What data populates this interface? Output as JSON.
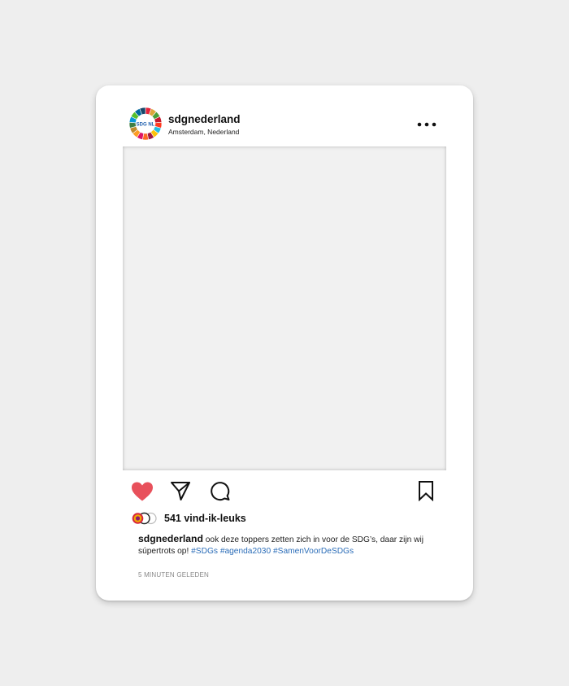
{
  "post": {
    "username": "sdgnederland",
    "location": "Amsterdam, Nederland",
    "avatar_label": "SDG NL",
    "likes": "541 vind-ik-leuks",
    "caption": {
      "username": "sdgnederland",
      "text": " ook deze toppers zetten zich in voor de SDG’s, daar zijn wij súpertrots op! ",
      "hashtags": [
        "#SDGs",
        "#agenda2030",
        "#SamenVoorDeSDGs"
      ]
    },
    "timestamp": "5 MINUTEN GELEDEN"
  },
  "icons": {
    "more": "more-options-icon",
    "like": "heart-icon",
    "share": "send-icon",
    "comment": "comment-icon",
    "save": "bookmark-icon"
  },
  "colors": {
    "heart": "#e8505b",
    "hashtag": "#2b6db8",
    "background": "#eeeeee"
  }
}
